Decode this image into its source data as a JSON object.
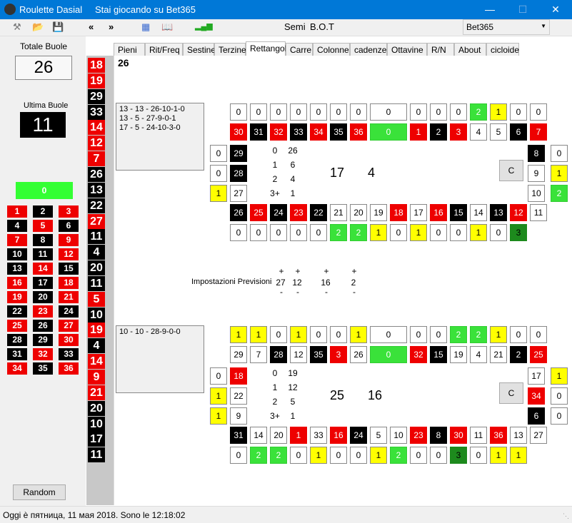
{
  "app": {
    "title": "Roulette Dasial",
    "subtitle": "Stai giocando su Bet365"
  },
  "toolbar": {
    "back": "«",
    "forward": "»",
    "semi": "Semi",
    "bot": "B.O.T",
    "combo": "Bet365"
  },
  "left": {
    "totale_label": "Totale Buole",
    "totale_value": "26",
    "ultima_label": "Ultima Buole",
    "ultima_value": "11",
    "zero": "0",
    "random_button": "Random",
    "grid": [
      [
        "1",
        "2",
        "3"
      ],
      [
        "4",
        "5",
        "6"
      ],
      [
        "7",
        "8",
        "9"
      ],
      [
        "10",
        "11",
        "12"
      ],
      [
        "13",
        "14",
        "15"
      ],
      [
        "16",
        "17",
        "18"
      ],
      [
        "19",
        "20",
        "21"
      ],
      [
        "22",
        "23",
        "24"
      ],
      [
        "25",
        "26",
        "27"
      ],
      [
        "28",
        "29",
        "30"
      ],
      [
        "31",
        "32",
        "33"
      ],
      [
        "34",
        "35",
        "36"
      ]
    ],
    "grid_colors": [
      [
        "r",
        "b",
        "r"
      ],
      [
        "b",
        "r",
        "b"
      ],
      [
        "r",
        "b",
        "r"
      ],
      [
        "b",
        "b",
        "r"
      ],
      [
        "b",
        "r",
        "b"
      ],
      [
        "r",
        "b",
        "r"
      ],
      [
        "r",
        "b",
        "r"
      ],
      [
        "b",
        "r",
        "b"
      ],
      [
        "r",
        "b",
        "r"
      ],
      [
        "b",
        "b",
        "r"
      ],
      [
        "b",
        "r",
        "b"
      ],
      [
        "r",
        "b",
        "r"
      ]
    ]
  },
  "strip": {
    "numbers": [
      "18",
      "19",
      "29",
      "33",
      "14",
      "12",
      "7",
      "26",
      "13",
      "22",
      "27",
      "11",
      "4",
      "20",
      "11",
      "5",
      "10",
      "19",
      "4",
      "14",
      "9",
      "21",
      "20",
      "10",
      "17",
      "11"
    ],
    "colors": [
      "r",
      "r",
      "b",
      "b",
      "r",
      "r",
      "r",
      "b",
      "b",
      "b",
      "r",
      "b",
      "b",
      "b",
      "b",
      "r",
      "b",
      "r",
      "b",
      "r",
      "r",
      "r",
      "b",
      "b",
      "b",
      "b"
    ]
  },
  "tabs": [
    "Pieni",
    "Rit/Freq",
    "Sestine",
    "Terzine",
    "Rettangoli",
    "Carre",
    "Colonne",
    "cadenze",
    "Ottavine",
    "R/N",
    "About",
    "cicloide"
  ],
  "main": {
    "counter": "26",
    "top": {
      "list": [
        "13 - 13  - 26-10-1-0",
        "13 - 5  - 27-9-0-1",
        "17 - 5  - 24-10-3-0"
      ],
      "row1_vals": [
        "0",
        "0",
        "0",
        "0",
        "0",
        "0",
        "0",
        "0",
        "0",
        "0",
        "0",
        "2",
        "1",
        "0",
        "0"
      ],
      "row1_cls": [
        "w",
        "w",
        "w",
        "w",
        "w",
        "w",
        "w",
        "w",
        "w",
        "w",
        "w",
        "g",
        "y",
        "w",
        "w"
      ],
      "row2_vals": [
        "30",
        "31",
        "32",
        "33",
        "34",
        "35",
        "36",
        "0",
        "1",
        "2",
        "3",
        "4",
        "5",
        "6",
        "7"
      ],
      "row2_cls": [
        "r",
        "b",
        "r",
        "b",
        "r",
        "b",
        "r",
        "g",
        "r",
        "b",
        "r",
        "w",
        "w",
        "b",
        "r"
      ],
      "left_nums": [
        "29",
        "28",
        "27"
      ],
      "left_ncls": [
        "b",
        "b",
        "w"
      ],
      "left_vals": [
        "0",
        "0",
        "1"
      ],
      "left_vcls": [
        "w",
        "w",
        "y"
      ],
      "right_nums": [
        "8",
        "9",
        "10"
      ],
      "right_ncls": [
        "b",
        "w",
        "w"
      ],
      "right_vals": [
        "0",
        "1",
        "2"
      ],
      "right_vcls": [
        "w",
        "y",
        "g"
      ],
      "stats_labels": [
        "0",
        "1",
        "2",
        "3+"
      ],
      "stats_values": [
        "26",
        "6",
        "4",
        "1"
      ],
      "big1": "17",
      "big2": "4",
      "c_button": "C",
      "row3_vals": [
        "26",
        "25",
        "24",
        "23",
        "22",
        "21",
        "20",
        "19",
        "18",
        "17",
        "16",
        "15",
        "14",
        "13",
        "12",
        "11"
      ],
      "row3_cls": [
        "b",
        "r",
        "b",
        "r",
        "b",
        "w",
        "w",
        "w",
        "r",
        "w",
        "r",
        "b",
        "w",
        "b",
        "r",
        "w"
      ],
      "row4_vals": [
        "0",
        "0",
        "0",
        "0",
        "0",
        "2",
        "2",
        "1",
        "0",
        "1",
        "0",
        "0",
        "1",
        "0",
        "3"
      ],
      "row4_cls": [
        "w",
        "w",
        "w",
        "w",
        "w",
        "g",
        "g",
        "y",
        "w",
        "y",
        "w",
        "w",
        "y",
        "w",
        "dg"
      ]
    },
    "prev": {
      "label": "Impostazioni Previsioni",
      "plus": "+",
      "minus": "-",
      "vals": [
        "27",
        "12",
        "16",
        "2"
      ]
    },
    "bottom": {
      "list": [
        "10 - 10  - 28-9-0-0"
      ],
      "row1_vals": [
        "1",
        "1",
        "0",
        "1",
        "0",
        "0",
        "1",
        "0",
        "0",
        "0",
        "2",
        "2",
        "1",
        "0",
        "0"
      ],
      "row1_cls": [
        "y",
        "y",
        "w",
        "y",
        "w",
        "w",
        "y",
        "w",
        "w",
        "w",
        "g",
        "g",
        "y",
        "w",
        "w"
      ],
      "row2_vals": [
        "29",
        "7",
        "28",
        "12",
        "35",
        "3",
        "26",
        "0",
        "32",
        "15",
        "19",
        "4",
        "21",
        "2",
        "25"
      ],
      "row2_cls": [
        "w",
        "w",
        "b",
        "w",
        "b",
        "r",
        "w",
        "g",
        "r",
        "b",
        "w",
        "w",
        "w",
        "b",
        "r"
      ],
      "left_nums": [
        "18",
        "22",
        "9"
      ],
      "left_ncls": [
        "r",
        "w",
        "w"
      ],
      "left_vals": [
        "0",
        "1",
        "1"
      ],
      "left_vcls": [
        "w",
        "y",
        "y"
      ],
      "right_nums": [
        "17",
        "34",
        "6"
      ],
      "right_ncls": [
        "w",
        "r",
        "b"
      ],
      "right_vals": [
        "1",
        "0",
        "0"
      ],
      "right_vcls": [
        "y",
        "w",
        "w"
      ],
      "stats_labels": [
        "0",
        "1",
        "2",
        "3+"
      ],
      "stats_values": [
        "19",
        "12",
        "5",
        "1"
      ],
      "big1": "25",
      "big2": "16",
      "c_button": "C",
      "row3_vals": [
        "31",
        "14",
        "20",
        "1",
        "33",
        "16",
        "24",
        "5",
        "10",
        "23",
        "8",
        "30",
        "11",
        "36",
        "13",
        "27"
      ],
      "row3_cls": [
        "b",
        "w",
        "w",
        "r",
        "w",
        "r",
        "b",
        "w",
        "w",
        "r",
        "b",
        "r",
        "w",
        "r",
        "w",
        "w"
      ],
      "row4_vals": [
        "0",
        "2",
        "2",
        "0",
        "1",
        "0",
        "0",
        "1",
        "2",
        "0",
        "0",
        "3",
        "0",
        "1",
        "1"
      ],
      "row4_cls": [
        "w",
        "g",
        "g",
        "w",
        "y",
        "w",
        "w",
        "y",
        "g",
        "w",
        "w",
        "dg",
        "w",
        "y",
        "y"
      ]
    }
  },
  "status": "Oggi è пятница, 11 мая 2018. Sono le 12:18:02"
}
